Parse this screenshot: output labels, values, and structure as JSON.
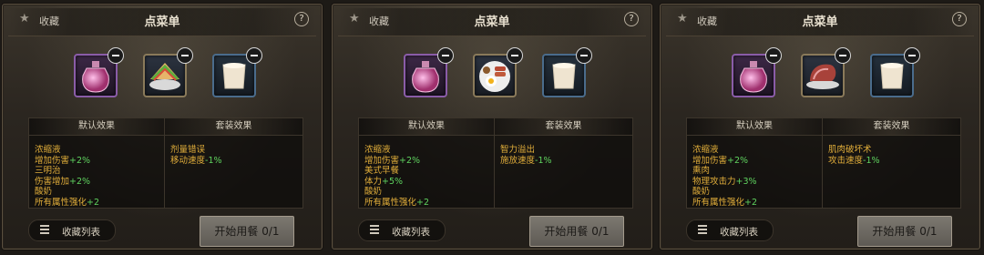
{
  "panels": [
    {
      "fav_label": "收藏",
      "title": "点菜单",
      "help": "?",
      "foods": [
        "potion",
        "sandwich",
        "milk"
      ],
      "default_header": "默认效果",
      "default_effects": [
        {
          "text": "浓缩液",
          "value": ""
        },
        {
          "text": "增加伤害",
          "value": "+2%"
        },
        {
          "text": "三明治",
          "value": ""
        },
        {
          "text": "伤害增加",
          "value": "+2%"
        },
        {
          "text": "酸奶",
          "value": ""
        },
        {
          "text": "所有属性强化",
          "value": "+2"
        }
      ],
      "set_header": "套装效果",
      "set_effects": [
        {
          "text": "剂量错误",
          "value": ""
        },
        {
          "text": "移动速度",
          "value": "-1%"
        }
      ],
      "fav_list_label": "收藏列表",
      "start_label": "开始用餐 0/1"
    },
    {
      "fav_label": "收藏",
      "title": "点菜单",
      "help": "?",
      "foods": [
        "potion",
        "breakfast",
        "milk"
      ],
      "default_header": "默认效果",
      "default_effects": [
        {
          "text": "浓缩液",
          "value": ""
        },
        {
          "text": "增加伤害",
          "value": "+2%"
        },
        {
          "text": "美式早餐",
          "value": ""
        },
        {
          "text": "体力",
          "value": "+5%"
        },
        {
          "text": "酸奶",
          "value": ""
        },
        {
          "text": "所有属性强化",
          "value": "+2"
        }
      ],
      "set_header": "套装效果",
      "set_effects": [
        {
          "text": "智力溢出",
          "value": ""
        },
        {
          "text": "施放速度",
          "value": "-1%"
        }
      ],
      "fav_list_label": "收藏列表",
      "start_label": "开始用餐 0/1"
    },
    {
      "fav_label": "收藏",
      "title": "点菜单",
      "help": "?",
      "foods": [
        "potion",
        "ham",
        "milk"
      ],
      "default_header": "默认效果",
      "default_effects": [
        {
          "text": "浓缩液",
          "value": ""
        },
        {
          "text": "增加伤害",
          "value": "+2%"
        },
        {
          "text": "熏肉",
          "value": ""
        },
        {
          "text": "物理攻击力",
          "value": "+3%"
        },
        {
          "text": "酸奶",
          "value": ""
        },
        {
          "text": "所有属性强化",
          "value": "+2"
        }
      ],
      "set_header": "套装效果",
      "set_effects": [
        {
          "text": "肌肉破坏术",
          "value": ""
        },
        {
          "text": "攻击速度",
          "value": "-1%"
        }
      ],
      "fav_list_label": "收藏列表",
      "start_label": "开始用餐 0/1"
    }
  ],
  "colors": {
    "effect_name": "#e0ad3a",
    "effect_value": "#5fd35f"
  }
}
